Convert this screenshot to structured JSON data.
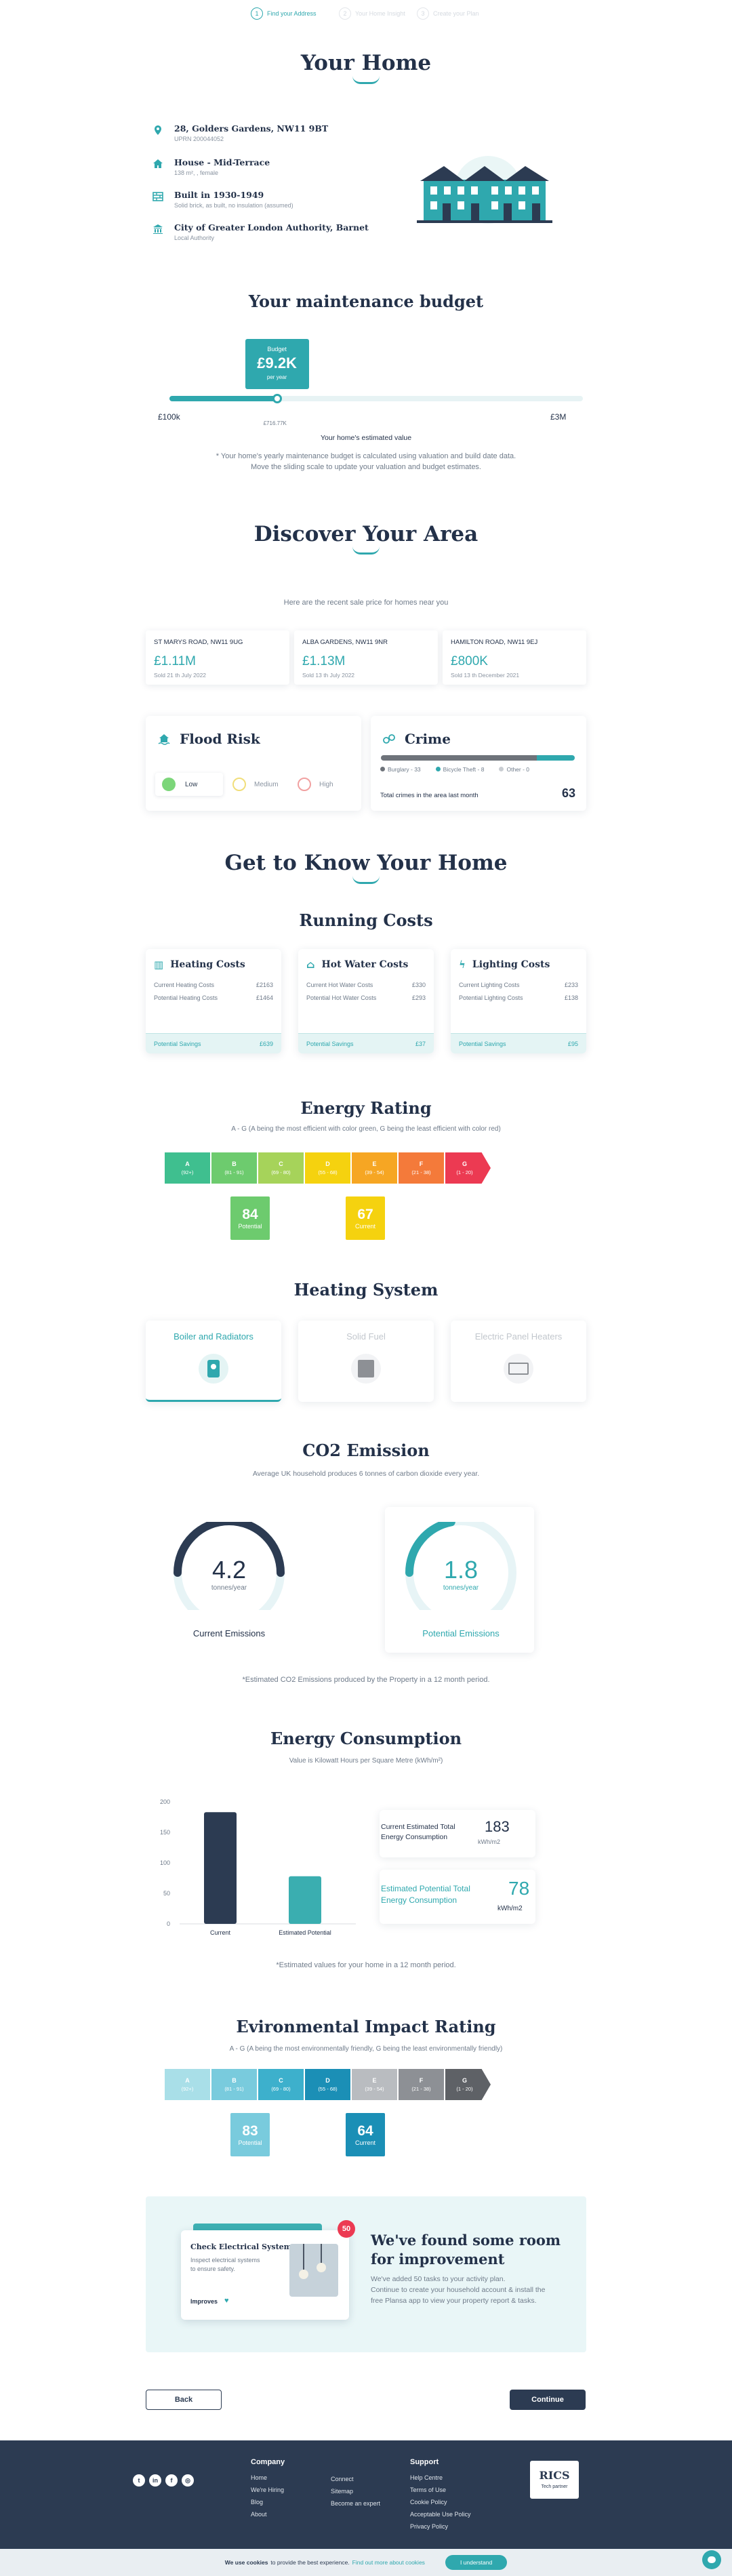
{
  "stepper": {
    "steps": [
      {
        "num": "1",
        "label": "Find your Address"
      },
      {
        "num": "2",
        "label": "Your Home Insight"
      },
      {
        "num": "3",
        "label": "Create your Plan"
      }
    ]
  },
  "home": {
    "title": "Your Home",
    "address": {
      "title": "28, Golders Gardens, NW11 9BT",
      "sub": "UPRN 200044052"
    },
    "type": {
      "title": "House - Mid-Terrace",
      "sub": "138 m², , female"
    },
    "built": {
      "title": "Built in 1930-1949",
      "sub": "Solid brick, as built, no insulation (assumed)"
    },
    "authority": {
      "title": "City of Greater London Authority, Barnet",
      "sub": "Local Authority"
    }
  },
  "budget": {
    "title": "Your maintenance budget",
    "badge_label": "Budget",
    "badge_value": "£9.2K",
    "badge_period": "per year",
    "min_label": "£100k",
    "max_label": "£3M",
    "value_label": "£716.77K",
    "position_fraction": 0.26,
    "estimate_label": "Your home's estimated value",
    "note_line1": "* Your home's yearly maintenance budget is calculated using valuation and build date data.",
    "note_line2": "Move the sliding scale to update your valuation and budget estimates."
  },
  "area": {
    "title": "Discover Your Area",
    "intro": "Here are the recent sale price for homes near you",
    "sales": [
      {
        "street": "ST MARYS ROAD, NW11 9UG",
        "price": "£1.11M",
        "date": "Sold 21 th July 2022"
      },
      {
        "street": "ALBA GARDENS, NW11 9NR",
        "price": "£1.13M",
        "date": "Sold 13 th July 2022"
      },
      {
        "street": "HAMILTON ROAD, NW11 9EJ",
        "price": "£800K",
        "date": "Sold 13 th December 2021"
      }
    ],
    "flood": {
      "title": "Flood Risk",
      "low": "Low",
      "medium": "Medium",
      "high": "High"
    },
    "crime": {
      "title": "Crime",
      "legend": [
        {
          "label": "Burglary - 33",
          "value": 33,
          "color": "#6e737a"
        },
        {
          "label": "Bicycle Theft - 8",
          "value": 8,
          "color": "#2fa8ae"
        },
        {
          "label": "Other - 0",
          "value": 0,
          "color": "#c9cdd2"
        }
      ],
      "total_label": "Total crimes in the area last month",
      "total": "63"
    }
  },
  "know": {
    "title": "Get to Know Your Home"
  },
  "running": {
    "title": "Running Costs",
    "cards": [
      {
        "title": "Heating Costs",
        "current_label": "Current Heating Costs",
        "current": "£2163",
        "potential_label": "Potential Heating Costs",
        "potential": "£1464",
        "savings_label": "Potential Savings",
        "savings": "£639"
      },
      {
        "title": "Hot Water Costs",
        "current_label": "Current Hot Water Costs",
        "current": "£330",
        "potential_label": "Potential Hot Water Costs",
        "potential": "£293",
        "savings_label": "Potential Savings",
        "savings": "£37"
      },
      {
        "title": "Lighting Costs",
        "current_label": "Current Lighting Costs",
        "current": "£233",
        "potential_label": "Potential Lighting Costs",
        "potential": "£138",
        "savings_label": "Potential Savings",
        "savings": "£95"
      }
    ]
  },
  "energy_rating": {
    "title": "Energy Rating",
    "sub": "A - G (A being the most efficient with color green, G being the least efficient with color red)",
    "bands": [
      {
        "letter": "A",
        "range": "(92+)",
        "color": "#3fbf8f"
      },
      {
        "letter": "B",
        "range": "(81 - 91)",
        "color": "#6dcb6e"
      },
      {
        "letter": "C",
        "range": "(69 - 80)",
        "color": "#a6d35a"
      },
      {
        "letter": "D",
        "range": "(55 - 68)",
        "color": "#f5d20f"
      },
      {
        "letter": "E",
        "range": "(39 - 54)",
        "color": "#f6a623"
      },
      {
        "letter": "F",
        "range": "(21 - 38)",
        "color": "#f47a3a"
      },
      {
        "letter": "G",
        "range": "(1 - 20)",
        "color": "#ec3a52"
      }
    ],
    "potential": {
      "value": "84",
      "label": "Potential",
      "color": "#6dcb6e"
    },
    "current": {
      "value": "67",
      "label": "Current",
      "color": "#f5d20f"
    }
  },
  "heating": {
    "title": "Heating System",
    "options": [
      {
        "label": "Boiler and Radiators"
      },
      {
        "label": "Solid Fuel"
      },
      {
        "label": "Electric Panel Heaters"
      }
    ]
  },
  "co2": {
    "title": "CO2 Emission",
    "sub": "Average UK household produces 6 tonnes of carbon dioxide every year.",
    "current": {
      "value": "4.2",
      "unit": "tonnes/year",
      "label": "Current Emissions",
      "fraction": 0.5
    },
    "potential": {
      "value": "1.8",
      "unit": "tonnes/year",
      "label": "Potential Emissions",
      "fraction": 0.22
    },
    "note": "*Estimated CO2 Emissions produced by the Property in a 12 month period."
  },
  "consumption": {
    "title": "Energy Consumption",
    "sub": "Value is Kilowatt Hours per Square Metre (kWh/m²)",
    "current_box_label": "Current Estimated Total Energy Consumption",
    "current_box_value": "183",
    "current_box_unit": "kWh/m2",
    "potential_box_label": "Estimated Potential Total Energy Consumption",
    "potential_box_value": "78",
    "potential_box_unit": "kWh/m2",
    "note": "*Estimated values for your home in a 12 month period."
  },
  "chart_data": {
    "type": "bar",
    "categories": [
      "Current",
      "Estimated Potential"
    ],
    "values": [
      183,
      78
    ],
    "colors": [
      "#2c3b52",
      "#3aaeb0"
    ],
    "ylim": [
      0,
      200
    ],
    "yticks": [
      "0",
      "50",
      "100",
      "150",
      "200"
    ],
    "grid": false,
    "title": "",
    "xlabel": "",
    "ylabel": ""
  },
  "environmental": {
    "title": "Evironmental Impact Rating",
    "sub": "A - G (A being the most environmentally friendly, G being the least environmentally friendly)",
    "bands": [
      {
        "letter": "A",
        "range": "(92+)",
        "color": "#a9dfe8"
      },
      {
        "letter": "B",
        "range": "(81 - 91)",
        "color": "#79cbdd"
      },
      {
        "letter": "C",
        "range": "(69 - 80)",
        "color": "#3db0cc"
      },
      {
        "letter": "D",
        "range": "(55 - 68)",
        "color": "#1b8fb6"
      },
      {
        "letter": "E",
        "range": "(39 - 54)",
        "color": "#b9bcc0"
      },
      {
        "letter": "F",
        "range": "(21 - 38)",
        "color": "#8d9095"
      },
      {
        "letter": "G",
        "range": "(1 - 20)",
        "color": "#5e6166"
      }
    ],
    "potential": {
      "value": "83",
      "label": "Potential",
      "color": "#79cbdd"
    },
    "current": {
      "value": "64",
      "label": "Current",
      "color": "#1b8fb6"
    }
  },
  "improvement": {
    "badge": "50",
    "card_title": "Check Electrical Systems",
    "card_sub": "Inspect electrical systems to ensure safety.",
    "card_tag": "Improves",
    "title_line1": "We've found some room",
    "title_line2": "for improvement",
    "text_line1": "We've added 50 tasks to your activity plan.",
    "text_line2": "Continue to create your household account & install the",
    "text_line3": "free Plansa app to view your property report & tasks."
  },
  "nav": {
    "back": "Back",
    "continue": "Continue"
  },
  "footer": {
    "company_title": "Company",
    "company_links": [
      "Home",
      "We're Hiring",
      "Blog",
      "About"
    ],
    "mid_links": [
      "Connect",
      "Sitemap",
      "Become an expert"
    ],
    "support_title": "Support",
    "support_links": [
      "Help Centre",
      "Terms of Use",
      "Cookie Policy",
      "Acceptable Use Policy",
      "Privacy Policy"
    ],
    "rics_text": "RICS",
    "rics_sub": "Tech partner"
  },
  "cookie": {
    "text": "We use cookies",
    "text2": "to provide the best experience.",
    "link": "Find out more about cookies",
    "button": "I understand"
  },
  "colors": {
    "teal": "#2fa8ae",
    "navy": "#2c3b52"
  }
}
